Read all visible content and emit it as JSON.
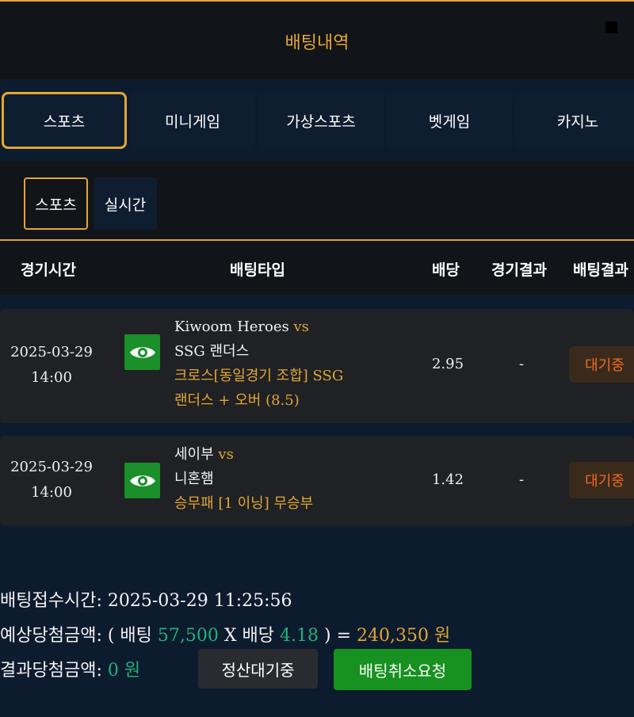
{
  "header": {
    "title": "배팅내역"
  },
  "category_tabs": [
    {
      "label": "스포츠",
      "active": true
    },
    {
      "label": "미니게임",
      "active": false
    },
    {
      "label": "가상스포츠",
      "active": false
    },
    {
      "label": "벳게임",
      "active": false
    },
    {
      "label": "카지노",
      "active": false
    }
  ],
  "sub_tabs": [
    {
      "label": "스포츠",
      "active": true
    },
    {
      "label": "실시간",
      "active": false
    }
  ],
  "table": {
    "headers": {
      "time": "경기시간",
      "bet_type": "배팅타입",
      "odds": "배당",
      "game_result": "경기결과",
      "bet_result": "배팅결과"
    },
    "rows": [
      {
        "date": "2025-03-29",
        "time": "14:00",
        "home": "Kiwoom Heroes",
        "vs": "vs",
        "away": "SSG 랜더스",
        "bet_type_line1": "크로스[동일경기 조합] SSG",
        "bet_type_line2": "랜더스 + 오버 (8.5)",
        "odds": "2.95",
        "result": "-",
        "status": "대기중"
      },
      {
        "date": "2025-03-29",
        "time": "14:00",
        "home": "세이부",
        "vs": "vs",
        "away": "니혼햄",
        "bet_type_line1": "승무패 [1 이닝] 무승부",
        "odds": "1.42",
        "result": "-",
        "status": "대기중"
      }
    ]
  },
  "summary": {
    "accept_label": "배팅접수시간:",
    "accept_time": "2025-03-29 11:25:56",
    "expected_label": "예상당첨금액:",
    "open_paren": "( 배팅",
    "bet_amount": "57,500",
    "times_label": "X 배당",
    "total_odds": "4.18",
    "close_paren": ") =",
    "expected_amount": "240,350 원",
    "result_label": "결과당첨금액:",
    "result_amount": "0 원"
  },
  "buttons": {
    "pending": "정산대기중",
    "cancel": "배팅취소요청"
  },
  "colors": {
    "accent": "#e2a634",
    "status_orange": "#f26b1d",
    "green": "#20b27a",
    "button_green": "#17911f"
  }
}
